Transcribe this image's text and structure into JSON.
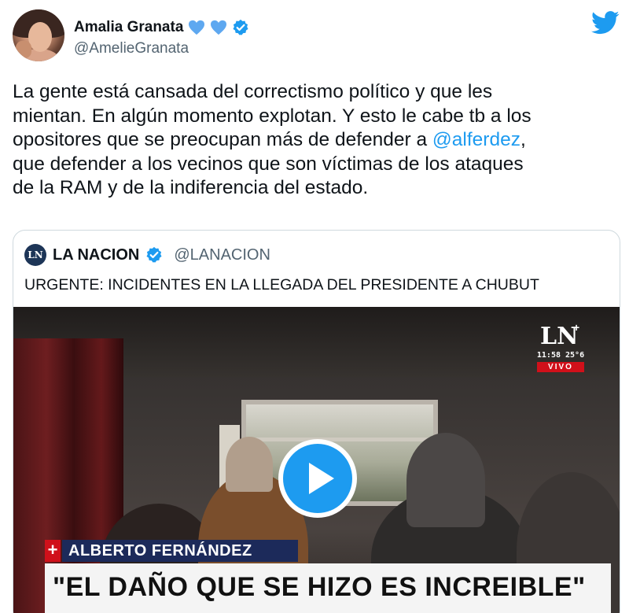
{
  "author": {
    "display_name": "Amalia Granata",
    "handle": "@AmelieGranata",
    "verified": true,
    "badge_hearts": 2
  },
  "tweet": {
    "line1": "La gente está cansada del correctismo político y que les",
    "line2": "mientan. En algún momento explotan. Y esto le cabe tb a los",
    "line3_before": "opositores que se preocupan más de defender a ",
    "mention": "@alferdez",
    "line3_after": ",",
    "line4": "que defender a los vecinos que son víctimas de los ataques",
    "line5": "de la RAM y de la indiferencia del estado."
  },
  "quote": {
    "logo_text": "LN",
    "display_name": "LA NACION",
    "handle": "@LANACION",
    "verified": true,
    "text": "URGENTE: INCIDENTES EN LA LLEGADA DEL PRESIDENTE A CHUBUT"
  },
  "video": {
    "bug_logo": "LN",
    "bug_plus": "+",
    "bug_time": "11:58 25°6",
    "bug_live": "VIVO",
    "lower_third_plus": "+",
    "lower_third_name": "ALBERTO FERNÁNDEZ",
    "lower_third_quote": "\"EL DAÑO QUE SE HIZO ES INCREIBLE\""
  },
  "colors": {
    "link": "#1d9bf0",
    "verified": "#1d9bf0",
    "heart": "#5ea8f0",
    "text": "#0f1419",
    "secondary": "#536471"
  },
  "icons": {
    "brand": "twitter-bird-icon",
    "play": "play-icon"
  }
}
